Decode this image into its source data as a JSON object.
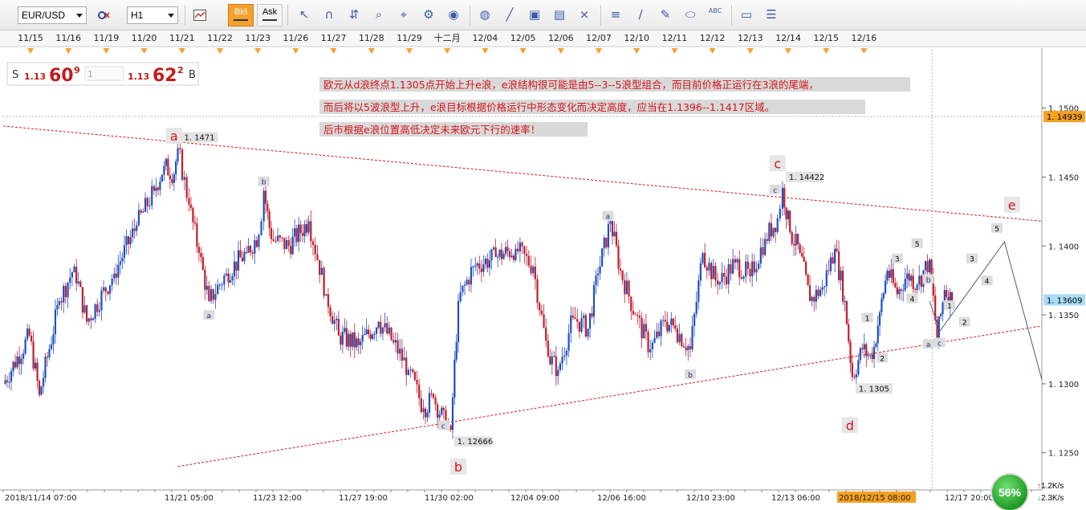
{
  "toolbar": {
    "symbol": "EUR/USD",
    "timeframe": "H1",
    "bid_label": "Bid",
    "ask_label": "Ask",
    "bid_active": true,
    "tools": [
      "indicator-icon",
      "cursor-icon",
      "magnet-icon",
      "measure-icon",
      "zoom-icon",
      "crosshair-icon",
      "settings-icon",
      "eye-icon",
      "globe-icon",
      "ruler-icon",
      "image-icon",
      "template-icon",
      "drawing-tools-icon",
      "fibonacci-icon",
      "trendline-icon",
      "pencil-icon",
      "ellipse-icon",
      "text-icon",
      "eraser-icon",
      "tree-icon"
    ]
  },
  "quote": {
    "sell_prefix": "S",
    "sell_big": "1.13",
    "sell_main": "60",
    "sell_sup": "9",
    "lot": "1",
    "buy_big": "1.13",
    "buy_main": "62",
    "buy_sup": "2",
    "buy_suffix": "B"
  },
  "annotation_text": [
    "欧元从d浪终点1.1305点开始上升e浪，e浪结构很可能是由5--3--5浪型组合，而目前价格正运行在3浪的尾端，",
    "而后将以5波浪型上升，e浪目标根据价格运行中形态变化而决定高度，应当在1.1396--1.1417区域。",
    "后市根据e浪位置高低决定未来欧元下行的速率！"
  ],
  "top_dates": [
    "11/15",
    "11/16",
    "11/19",
    "11/20",
    "11/21",
    "11/22",
    "11/23",
    "11/26",
    "11/27",
    "11/28",
    "11/29",
    "十二月",
    "12/04",
    "12/05",
    "12/06",
    "12/07",
    "12/10",
    "12/11",
    "12/12",
    "12/13",
    "12/14",
    "12/15",
    "12/16"
  ],
  "bottom_times": [
    "2018/11/14 07:00",
    "11/21 05:00",
    "11/23 12:00",
    "11/27 19:00",
    "11/30 02:00",
    "12/04 09:00",
    "12/06 16:00",
    "12/10 23:00",
    "12/13 06:00",
    "2018/12/15 08:00",
    "12/17 20:00"
  ],
  "speed": {
    "percent": "56%",
    "up": "1.2K/s",
    "down": "2.3K/s"
  },
  "chart_data": {
    "type": "candlestick",
    "symbol": "EUR/USD",
    "timeframe": "H1",
    "x_range": [
      "2018/11/14 07:00",
      "2018/12/19 00:00"
    ],
    "ylim": [
      1.123,
      1.154
    ],
    "y_ticks": [
      1.125,
      1.13,
      1.135,
      1.14,
      1.145,
      1.15
    ],
    "current_bid": 1.13609,
    "crosshair_price": 1.14939,
    "crosshair_time": "2018/12/15 08:00",
    "price_path": [
      {
        "t": "2018/11/14 07:00",
        "p": 1.13
      },
      {
        "t": "2018/11/15 04:00",
        "p": 1.1335
      },
      {
        "t": "2018/11/15 12:00",
        "p": 1.1292
      },
      {
        "t": "2018/11/16 04:00",
        "p": 1.136
      },
      {
        "t": "2018/11/16 16:00",
        "p": 1.1385
      },
      {
        "t": "2018/11/17 02:00",
        "p": 1.1345
      },
      {
        "t": "2018/11/18 00:00",
        "p": 1.138
      },
      {
        "t": "2018/11/18 18:00",
        "p": 1.1415
      },
      {
        "t": "2018/11/19 08:00",
        "p": 1.144
      },
      {
        "t": "2018/11/19 16:00",
        "p": 1.1458
      },
      {
        "t": "2018/11/20 00:00",
        "p": 1.1452
      },
      {
        "t": "2018/11/20 03:00",
        "p": 1.1471
      },
      {
        "t": "2018/11/20 12:00",
        "p": 1.143
      },
      {
        "t": "2018/11/20 20:00",
        "p": 1.1395
      },
      {
        "t": "2018/11/21 04:00",
        "p": 1.136
      },
      {
        "t": "2018/11/21 18:00",
        "p": 1.138
      },
      {
        "t": "2018/11/22 10:00",
        "p": 1.1395
      },
      {
        "t": "2018/11/22 20:00",
        "p": 1.1408
      },
      {
        "t": "2018/11/23 00:00",
        "p": 1.144
      },
      {
        "t": "2018/11/23 06:00",
        "p": 1.1405
      },
      {
        "t": "2018/11/23 20:00",
        "p": 1.14
      },
      {
        "t": "2018/11/24 12:00",
        "p": 1.1418
      },
      {
        "t": "2018/11/25 02:00",
        "p": 1.1365
      },
      {
        "t": "2018/11/25 12:00",
        "p": 1.1335
      },
      {
        "t": "2018/11/26 04:00",
        "p": 1.1328
      },
      {
        "t": "2018/11/26 20:00",
        "p": 1.1345
      },
      {
        "t": "2018/11/27 08:00",
        "p": 1.133
      },
      {
        "t": "2018/11/27 20:00",
        "p": 1.131
      },
      {
        "t": "2018/11/28 08:00",
        "p": 1.1282
      },
      {
        "t": "2018/11/28 16:00",
        "p": 1.129
      },
      {
        "t": "2018/11/29 02:00",
        "p": 1.127
      },
      {
        "t": "2018/11/29 06:00",
        "p": 1.12666
      },
      {
        "t": "2018/11/29 12:00",
        "p": 1.136
      },
      {
        "t": "2018/11/30 00:00",
        "p": 1.1385
      },
      {
        "t": "2018/11/30 18:00",
        "p": 1.1392
      },
      {
        "t": "2018/12/01 10:00",
        "p": 1.1398
      },
      {
        "t": "2018/12/02 00:00",
        "p": 1.1385
      },
      {
        "t": "2018/12/02 12:00",
        "p": 1.132
      },
      {
        "t": "2018/12/02 20:00",
        "p": 1.131
      },
      {
        "t": "2018/12/03 08:00",
        "p": 1.1348
      },
      {
        "t": "2018/12/03 20:00",
        "p": 1.134
      },
      {
        "t": "2018/12/04 04:00",
        "p": 1.138
      },
      {
        "t": "2018/12/04 14:00",
        "p": 1.1418
      },
      {
        "t": "2018/12/04 22:00",
        "p": 1.1382
      },
      {
        "t": "2018/12/05 10:00",
        "p": 1.135
      },
      {
        "t": "2018/12/05 22:00",
        "p": 1.1325
      },
      {
        "t": "2018/12/06 10:00",
        "p": 1.1345
      },
      {
        "t": "2018/12/06 18:00",
        "p": 1.134
      },
      {
        "t": "2018/12/07 06:00",
        "p": 1.1325
      },
      {
        "t": "2018/12/07 16:00",
        "p": 1.1395
      },
      {
        "t": "2018/12/08 04:00",
        "p": 1.1372
      },
      {
        "t": "2018/12/08 18:00",
        "p": 1.1388
      },
      {
        "t": "2018/12/09 06:00",
        "p": 1.1378
      },
      {
        "t": "2018/12/09 18:00",
        "p": 1.1405
      },
      {
        "t": "2018/12/10 04:00",
        "p": 1.142
      },
      {
        "t": "2018/12/10 08:00",
        "p": 1.14422
      },
      {
        "t": "2018/12/10 14:00",
        "p": 1.141
      },
      {
        "t": "2018/12/10 22:00",
        "p": 1.1395
      },
      {
        "t": "2018/12/11 06:00",
        "p": 1.136
      },
      {
        "t": "2018/12/11 16:00",
        "p": 1.137
      },
      {
        "t": "2018/12/12 02:00",
        "p": 1.1398
      },
      {
        "t": "2018/12/12 10:00",
        "p": 1.136
      },
      {
        "t": "2018/12/12 16:00",
        "p": 1.1305
      },
      {
        "t": "2018/12/13 00:00",
        "p": 1.1325
      },
      {
        "t": "2018/12/13 08:00",
        "p": 1.1318
      },
      {
        "t": "2018/12/13 14:00",
        "p": 1.1352
      },
      {
        "t": "2018/12/13 20:00",
        "p": 1.1382
      },
      {
        "t": "2018/12/14 04:00",
        "p": 1.1365
      },
      {
        "t": "2018/12/14 12:00",
        "p": 1.138
      },
      {
        "t": "2018/12/14 20:00",
        "p": 1.1372
      },
      {
        "t": "2018/12/15 06:00",
        "p": 1.139
      },
      {
        "t": "2018/12/15 12:00",
        "p": 1.1332
      },
      {
        "t": "2018/12/15 18:00",
        "p": 1.1368
      },
      {
        "t": "2018/12/16 00:00",
        "p": 1.136
      }
    ],
    "price_labels": [
      {
        "text": "1.1471",
        "t": "2018/11/20 03:00",
        "p": 1.1471
      },
      {
        "text": "1.14422",
        "t": "2018/12/10 08:00",
        "p": 1.14422
      },
      {
        "text": "1.12666",
        "t": "2018/11/29 06:00",
        "p": 1.12666
      },
      {
        "text": "1.1305",
        "t": "2018/12/12 16:00",
        "p": 1.1305
      }
    ],
    "major_waves": [
      {
        "label": "a",
        "t": "2018/11/20 00:00",
        "p": 1.148
      },
      {
        "label": "b",
        "t": "2018/11/29 12:00",
        "p": 1.124
      },
      {
        "label": "c",
        "t": "2018/12/10 04:00",
        "p": 1.146
      },
      {
        "label": "d",
        "t": "2018/12/12 14:00",
        "p": 1.127
      },
      {
        "label": "e",
        "t": "2018/12/18 00:00",
        "p": 1.143
      }
    ],
    "minor_waves": [
      {
        "label": "a",
        "t": "2018/11/21 04:00",
        "p": 1.135
      },
      {
        "label": "b",
        "t": "2018/11/23 00:00",
        "p": 1.1447
      },
      {
        "label": "c",
        "t": "2018/11/29 00:00",
        "p": 1.127
      },
      {
        "label": "a",
        "t": "2018/12/04 12:00",
        "p": 1.1422
      },
      {
        "label": "b",
        "t": "2018/12/07 06:00",
        "p": 1.1307
      },
      {
        "label": "c",
        "t": "2018/12/10 02:00",
        "p": 1.1441
      },
      {
        "label": "1",
        "t": "2018/12/13 04:00",
        "p": 1.1348
      },
      {
        "label": "2",
        "t": "2018/12/13 16:00",
        "p": 1.1319
      },
      {
        "label": "3",
        "t": "2018/12/14 04:00",
        "p": 1.1391
      },
      {
        "label": "4",
        "t": "2018/12/14 16:00",
        "p": 1.1362
      },
      {
        "label": "5",
        "t": "2018/12/14 20:00",
        "p": 1.1402
      },
      {
        "label": "b",
        "t": "2018/12/15 05:00",
        "p": 1.1376
      },
      {
        "label": "a",
        "t": "2018/12/15 05:00",
        "p": 1.1329
      },
      {
        "label": "c",
        "t": "2018/12/15 14:00",
        "p": 1.133
      },
      {
        "label": "1",
        "t": "2018/12/15 22:00",
        "p": 1.1357
      },
      {
        "label": "2",
        "t": "2018/12/16 10:00",
        "p": 1.1345
      },
      {
        "label": "3",
        "t": "2018/12/16 16:00",
        "p": 1.1391
      },
      {
        "label": "4",
        "t": "2018/12/17 04:00",
        "p": 1.1375
      },
      {
        "label": "5",
        "t": "2018/12/17 12:00",
        "p": 1.1413
      }
    ],
    "projection": [
      {
        "t": "2018/12/15 06:00",
        "p": 1.136
      },
      {
        "t": "2018/12/15 14:00",
        "p": 1.1338
      },
      {
        "t": "2018/12/17 18:00",
        "p": 1.1403
      },
      {
        "t": "2018/12/19 00:00",
        "p": 1.1303
      }
    ],
    "triangle_upper": [
      {
        "t": "2018/11/14 07:00",
        "p": 1.1487
      },
      {
        "t": "2018/12/19 00:00",
        "p": 1.1418
      }
    ],
    "triangle_lower": [
      {
        "t": "2018/11/20 03:00",
        "p": 1.124
      },
      {
        "t": "2018/12/19 00:00",
        "p": 1.1342
      }
    ],
    "colors": {
      "bull": "#1d4fc0",
      "bear": "#c21d2a",
      "trend": "#d21e1e",
      "projection": "#4b5a86",
      "accent": "#f6a02f",
      "bid_price_bg": "#aadcf6",
      "crosshair_bg": "#f6a020"
    }
  }
}
